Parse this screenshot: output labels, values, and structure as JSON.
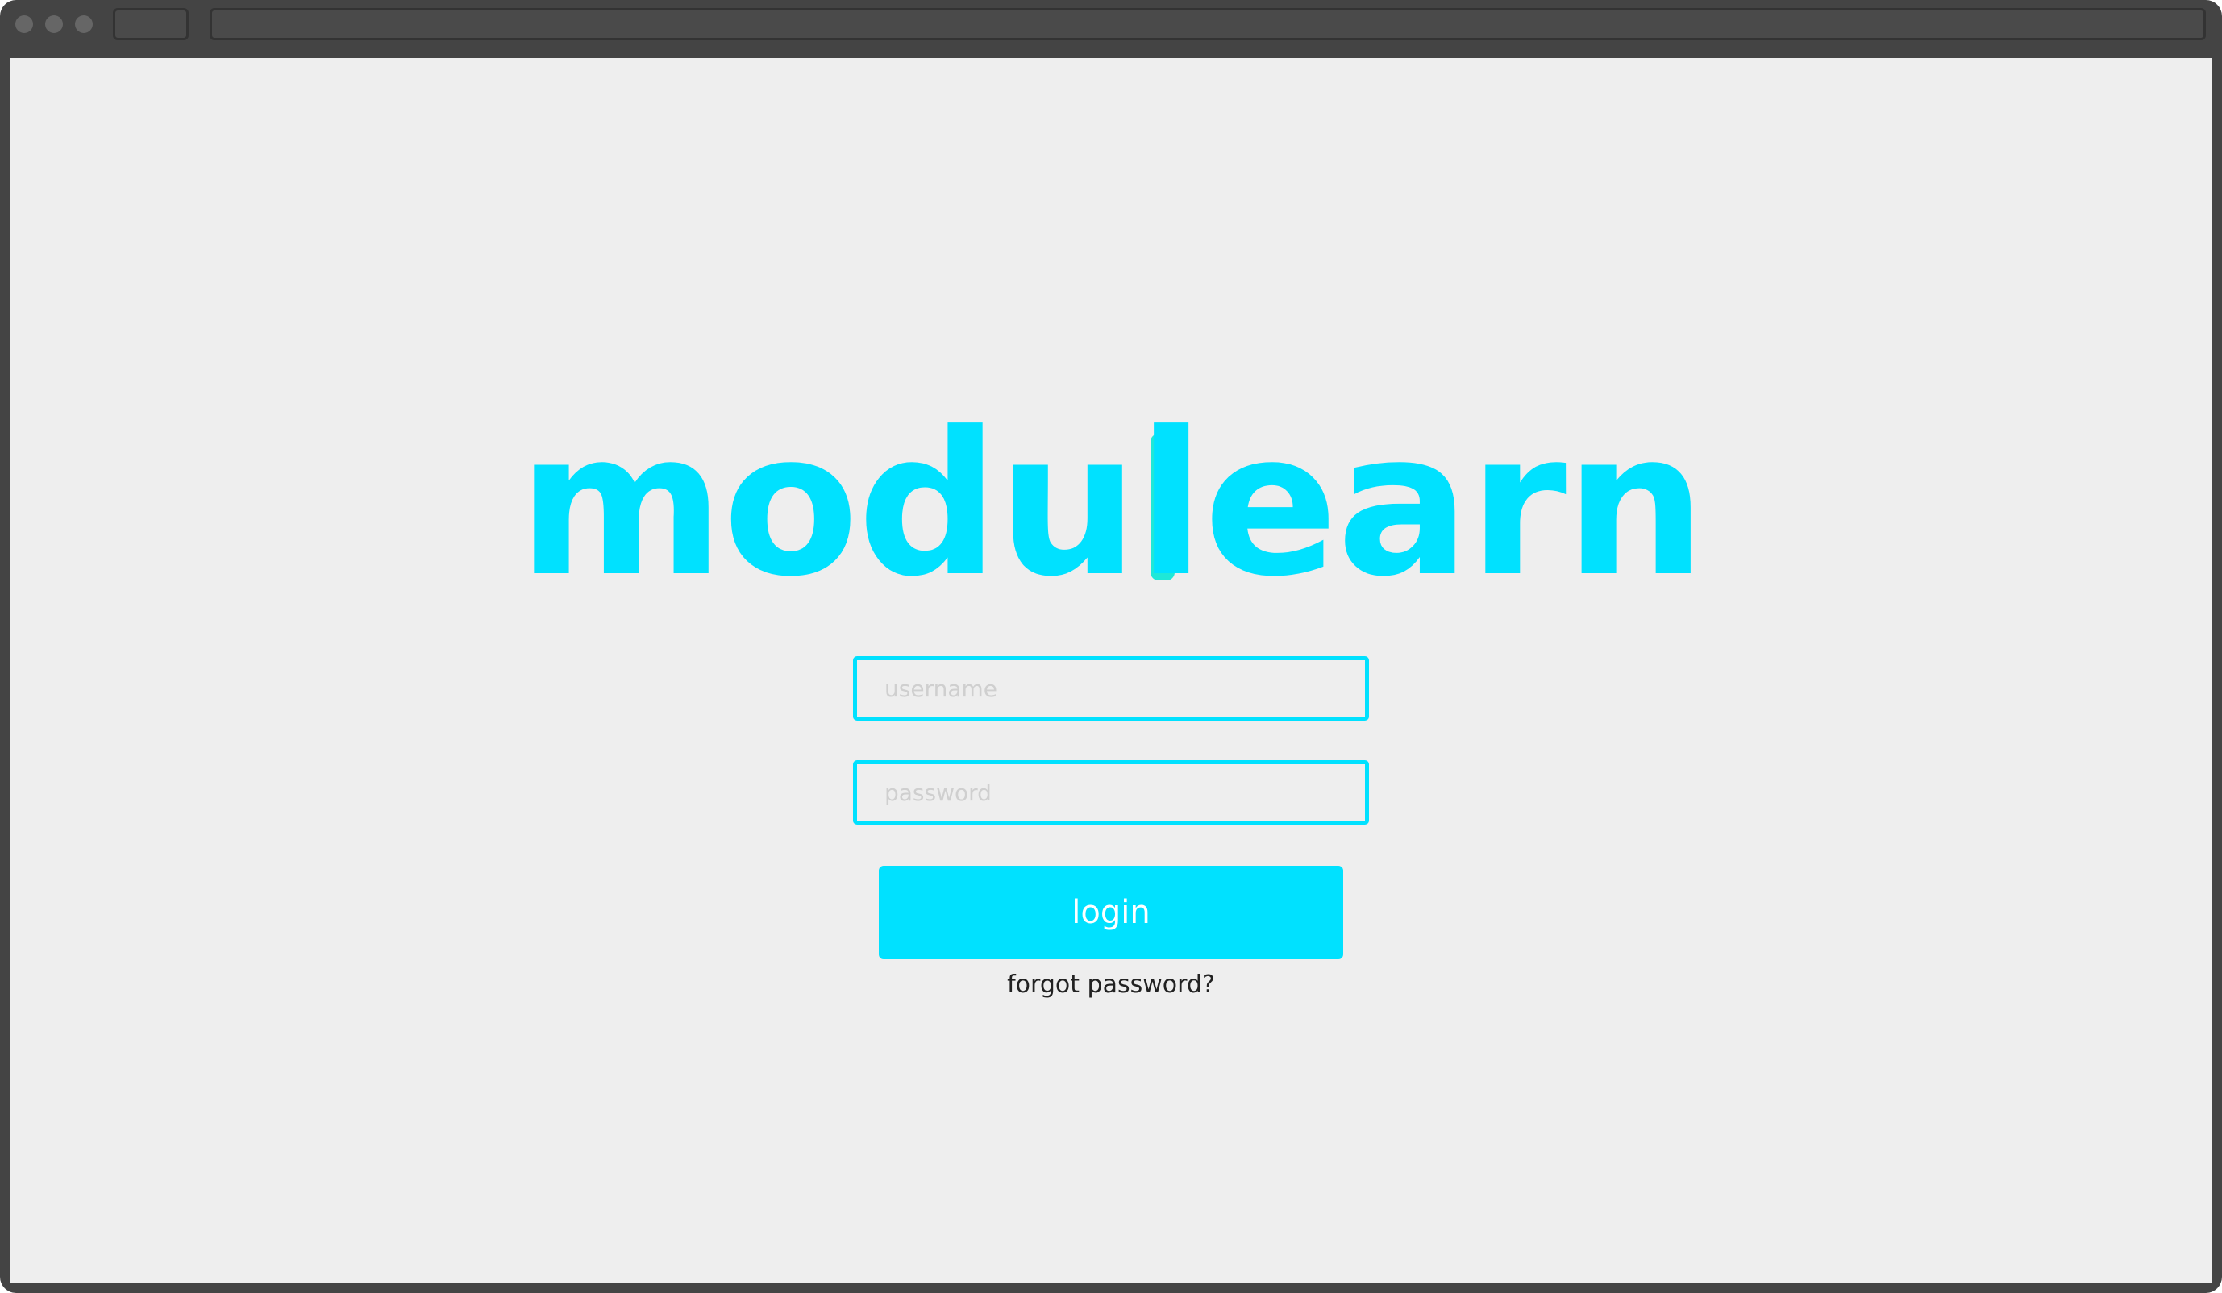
{
  "logo": {
    "text_before": "modu",
    "highlight_letter": "l",
    "text_after": "earn",
    "color": "#00e1ff",
    "accent_color": "#1ee8d8"
  },
  "form": {
    "username_placeholder": "username",
    "password_placeholder": "password",
    "login_label": "login",
    "forgot_label": "forgot password?"
  },
  "colors": {
    "brand": "#00e1ff",
    "background": "#eeeeee",
    "frame": "#444444"
  }
}
